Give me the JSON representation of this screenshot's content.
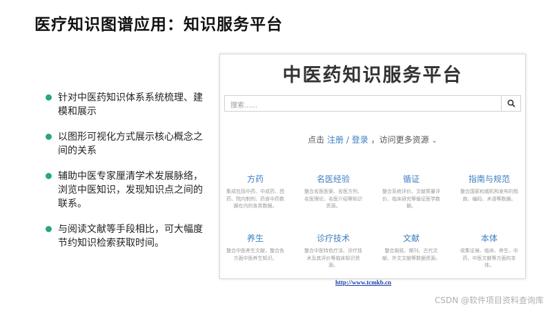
{
  "slide": {
    "title": "医疗知识图谱应用：知识服务平台"
  },
  "bullets": [
    "针对中医药知识体系系统梳理、建模和展示",
    "以图形可视化方式展示核心概念之间的关系",
    "辅助中医专家厘清学术发展脉络，浏览中医知识，发现知识点之间的联系。",
    "与阅读文献等手段相比，可大幅度节约知识检索获取时间。"
  ],
  "site": {
    "title": "中医药知识服务平台",
    "search_placeholder": "搜索......",
    "login_prefix": "点击",
    "register_link": "注册",
    "login_sep": "/",
    "login_link": "登录",
    "login_suffix": "，访问更多资源",
    "categories": [
      {
        "title": "方药",
        "desc": "集成包括中药、中成药、西药、院内制剂、药食中药数据在内的各类数据。"
      },
      {
        "title": "名医经验",
        "desc": "整合名医医案、名医方剂、名医理论、名医介绍等知识资源。"
      },
      {
        "title": "循证",
        "desc": "整合系统评价、文献质量评价、临床研究等循证医学数据。"
      },
      {
        "title": "指南与规范",
        "desc": "整合国家权威机构发布的指南、编码、术语等数据。"
      },
      {
        "title": "养生",
        "desc": "整合中医养生文献，整合各方面中医养生知识。"
      },
      {
        "title": "诊疗技术",
        "desc": "整合中医特色疗法、诊疗技术及其评价等临床知识资源。"
      },
      {
        "title": "文献",
        "desc": "整合报纸、期刊、古代文献、外文文献等数据资源。"
      },
      {
        "title": "本体",
        "desc": "收集证候、临床、养生、中药、中医文献等方面的本体。"
      }
    ]
  },
  "url": "http://www.tcmkb.cn",
  "watermark": "CSDN @软件项目资料查询库",
  "colors": {
    "bullet": "#2aa876",
    "link": "#3a7fc1",
    "url": "#1a3ea8"
  },
  "icons": {
    "search_button": "search-icon",
    "login_dropdown": "chevron-down-icon"
  }
}
